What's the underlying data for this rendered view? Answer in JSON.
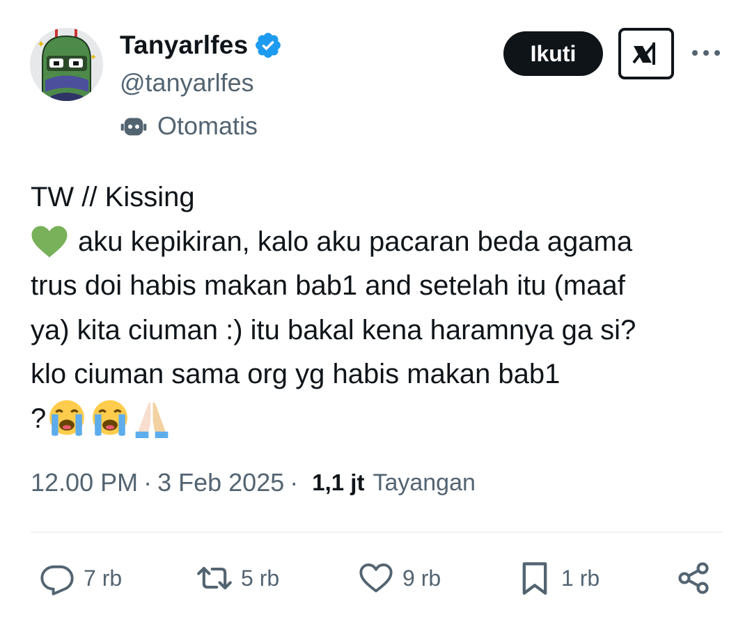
{
  "author": {
    "display_name": "Tanyarlfes",
    "handle": "@tanyarlfes",
    "verified": true,
    "automated_label": "Otomatis"
  },
  "header_actions": {
    "follow_label": "Ikuti",
    "grok_icon": "grok-icon",
    "more_icon": "more-icon"
  },
  "tweet": {
    "line1": "TW // Kissing",
    "line2": "aku kepikiran, kalo aku pacaran beda agama",
    "line3": "trus doi habis makan bab1 and setelah itu (maaf",
    "line4": "ya) kita ciuman :) itu bakal kena haramnya ga si?",
    "line5": "klo ciuman sama org yg habis makan bab1",
    "line6": "?",
    "emojis": [
      "green-heart",
      "loudly-crying-face",
      "loudly-crying-face",
      "folded-hands"
    ]
  },
  "meta": {
    "time": "12.00 PM",
    "separator": "·",
    "date": "3 Feb 2025",
    "views_count": "1,1 jt",
    "views_label": "Tayangan"
  },
  "actions": {
    "replies": "7 rb",
    "reposts": "5 rb",
    "likes": "9 rb",
    "bookmarks": "1 rb"
  },
  "colors": {
    "text_primary": "#0f1419",
    "text_secondary": "#536471",
    "verified_blue": "#1d9bf0",
    "divider": "#eff3f4",
    "green_heart": "#78b159"
  }
}
